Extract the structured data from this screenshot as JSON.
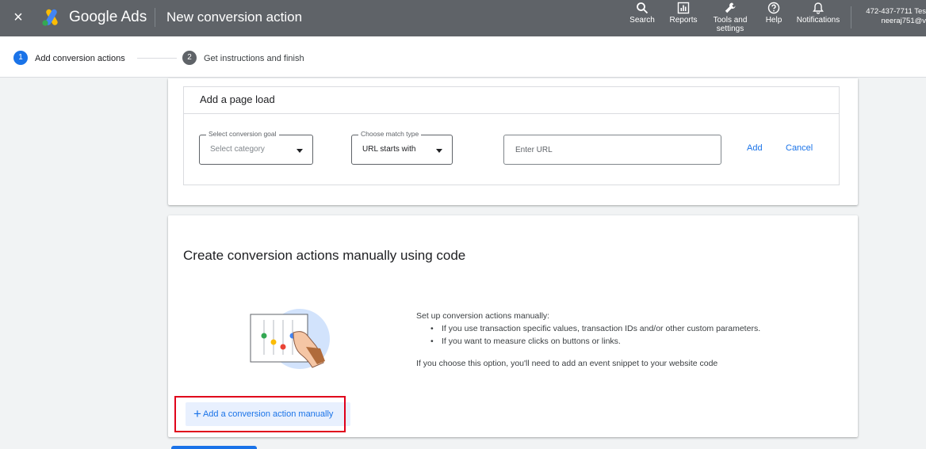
{
  "header": {
    "close_label": "×",
    "brand": "Google Ads",
    "page_title": "New conversion action",
    "nav": {
      "search": "Search",
      "reports": "Reports",
      "tools_line1": "Tools and",
      "tools_line2": "settings",
      "help": "Help",
      "notifications": "Notifications"
    },
    "account": {
      "line1": "472-437-7711 Tes",
      "line2": "neeraj751@v"
    }
  },
  "stepper": {
    "step1_number": "1",
    "step1_label": "Add conversion actions",
    "step2_number": "2",
    "step2_label": "Get instructions and finish"
  },
  "page_load_card": {
    "title": "Add a page load",
    "goal_select": {
      "legend": "Select conversion goal",
      "value": "Select category"
    },
    "match_select": {
      "legend": "Choose match type",
      "value": "URL starts with"
    },
    "url_placeholder": "Enter URL",
    "add_label": "Add",
    "cancel_label": "Cancel"
  },
  "manual_card": {
    "title": "Create conversion actions manually using code",
    "intro": "Set up conversion actions manually:",
    "bullets": [
      "If you use transaction specific values, transaction IDs and/or other custom parameters.",
      "If you want to measure clicks on buttons or links."
    ],
    "note": "If you choose this option, you'll need to add an event snippet to your website code",
    "add_manual_label": "Add a conversion action manually"
  },
  "colors": {
    "topbar": "#5f6368",
    "accent": "#1a73e8",
    "highlight": "#e0001b"
  }
}
